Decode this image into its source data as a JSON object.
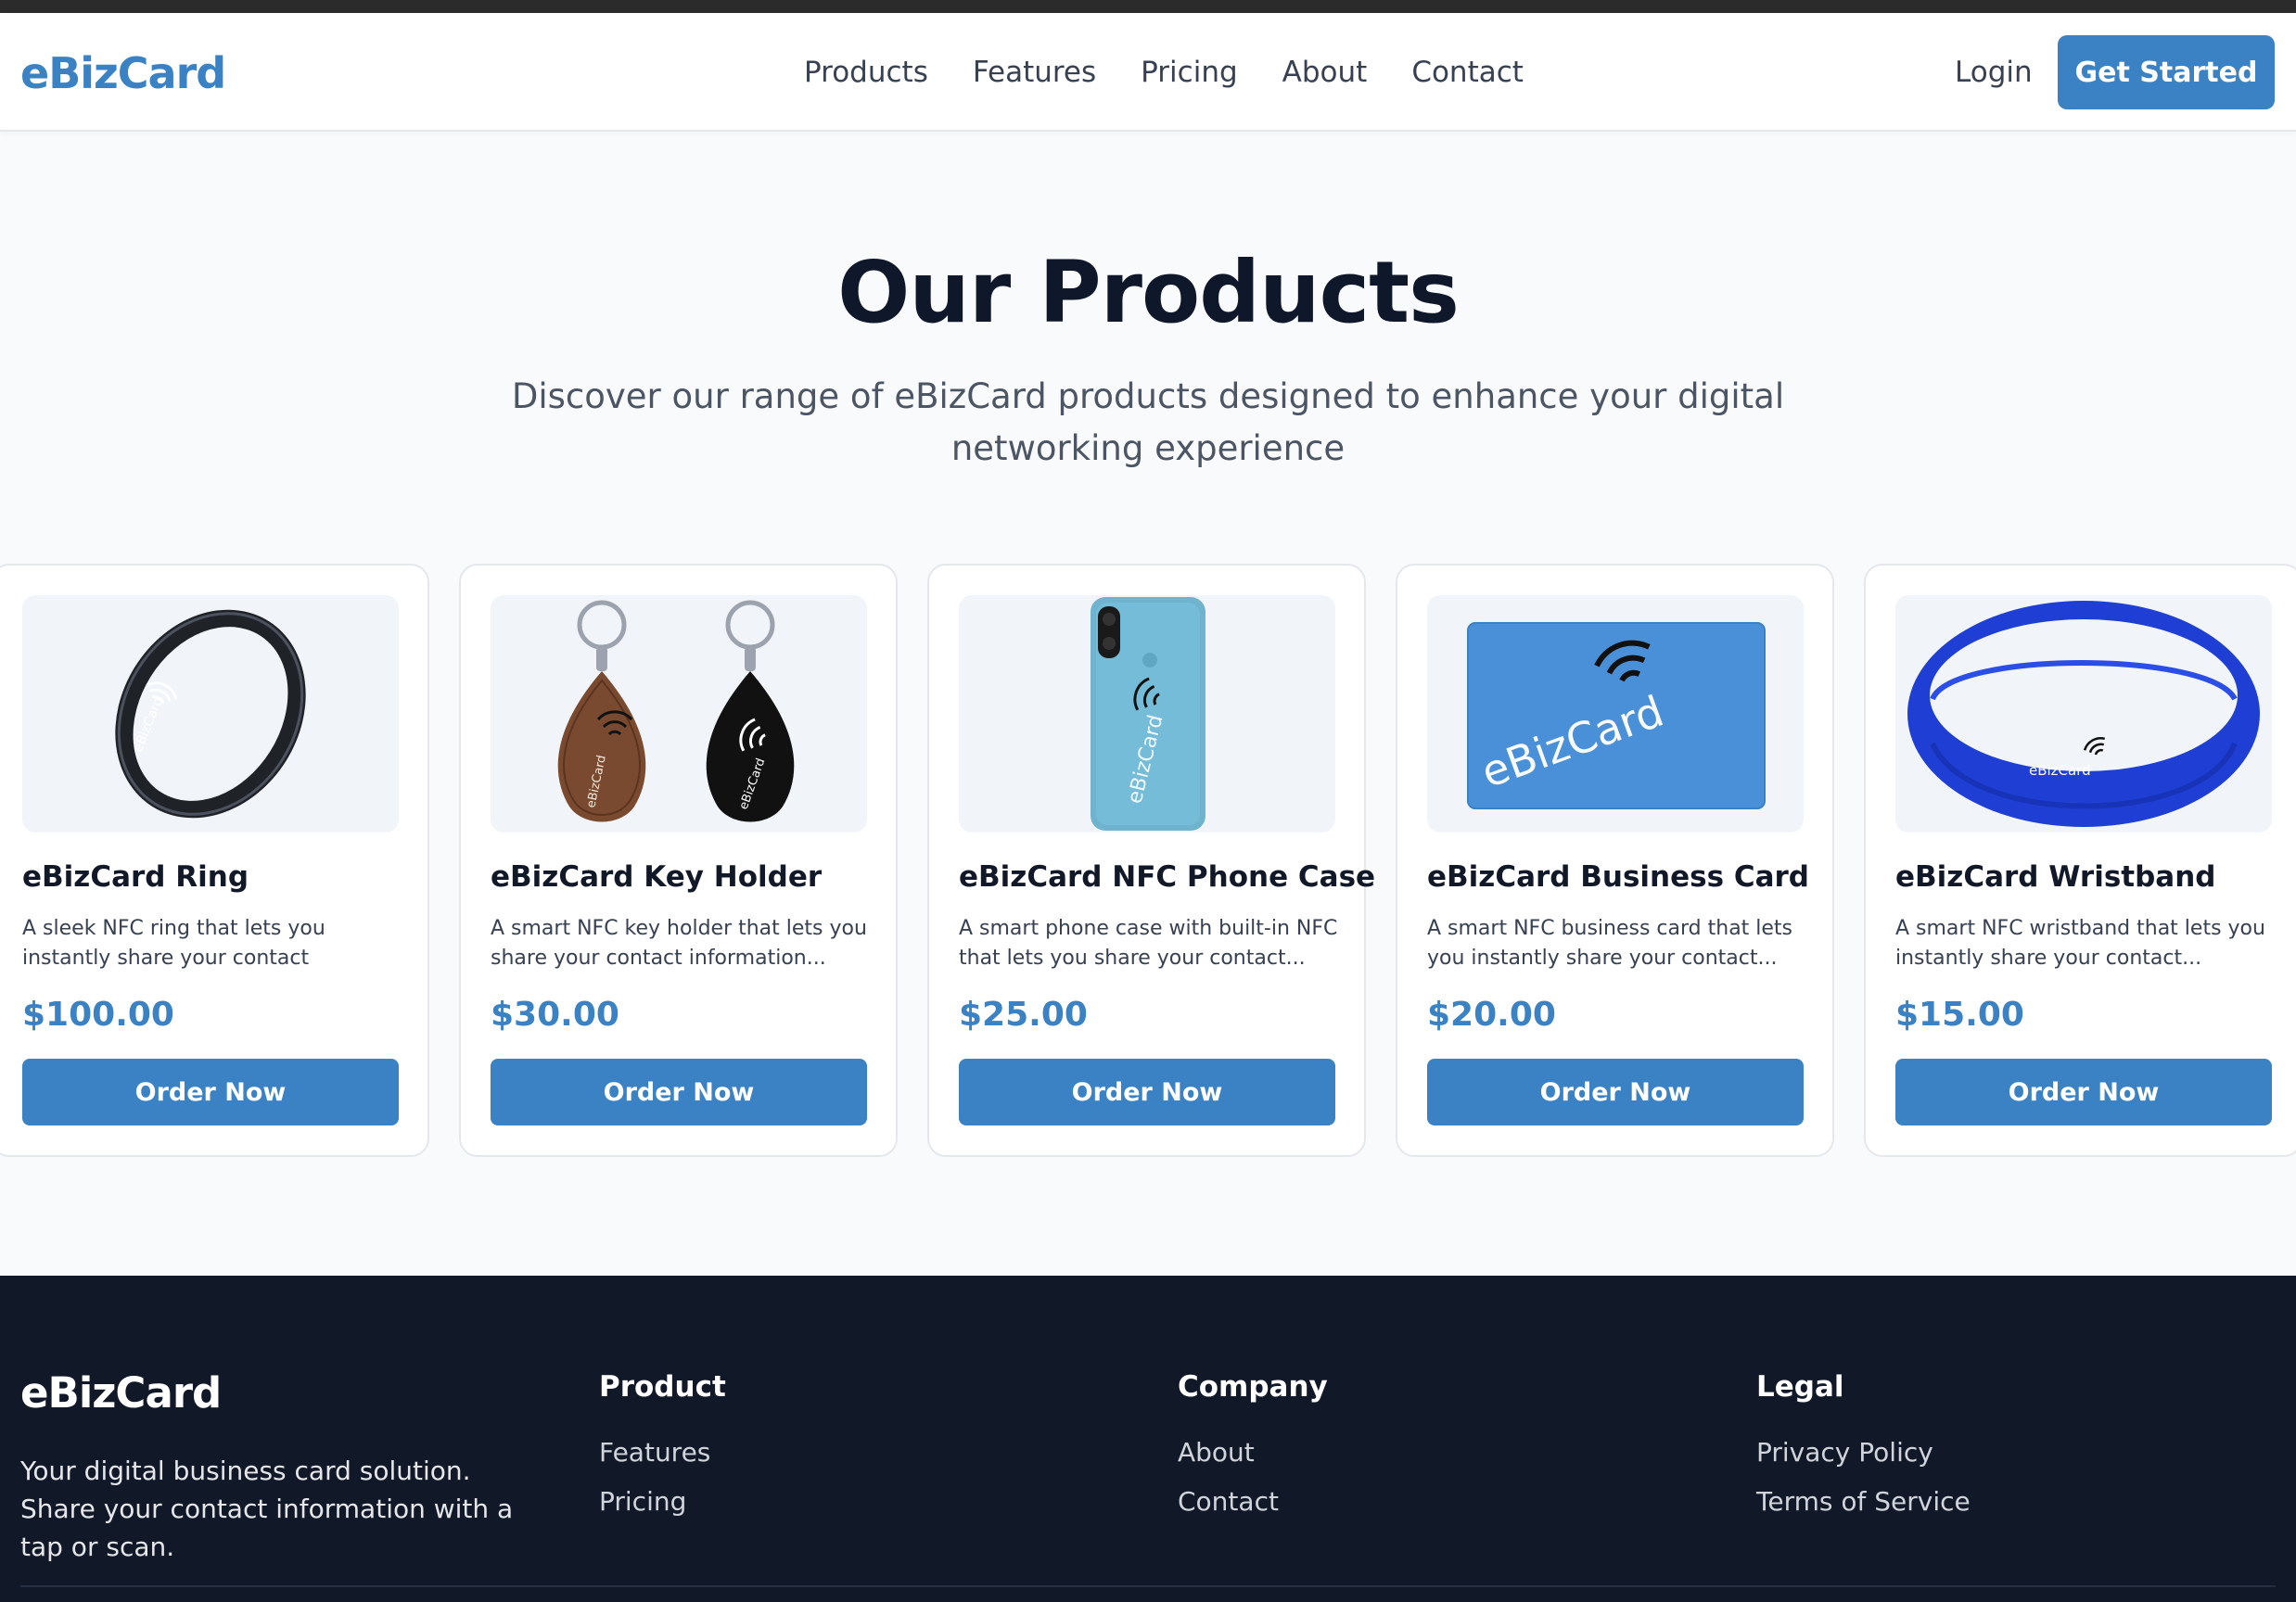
{
  "header": {
    "logo": "eBizCard",
    "nav": [
      "Products",
      "Features",
      "Pricing",
      "About",
      "Contact"
    ],
    "login": "Login",
    "cta": "Get Started"
  },
  "hero": {
    "title": "Our Products",
    "subtitle": "Discover our range of eBizCard products designed to enhance your digital networking experience"
  },
  "products": [
    {
      "name": "eBizCard Ring",
      "description": "A sleek NFC ring that lets you instantly share your contact information with ...",
      "price": "$100.00",
      "button": "Order Now",
      "image_icon": "ring-image",
      "image_text": "eBizCard"
    },
    {
      "name": "eBizCard Key Holder",
      "description": "A smart NFC key holder that lets you share your contact information...",
      "price": "$30.00",
      "button": "Order Now",
      "image_icon": "key-holder-image",
      "image_text": "eBizCard"
    },
    {
      "name": "eBizCard NFC Phone Case",
      "description": "A smart phone case with built-in NFC that lets you share your contact...",
      "price": "$25.00",
      "button": "Order Now",
      "image_icon": "phone-case-image",
      "image_text": "eBizCard"
    },
    {
      "name": "eBizCard Business Card",
      "description": "A smart NFC business card that lets you instantly share your contact...",
      "price": "$20.00",
      "button": "Order Now",
      "image_icon": "business-card-image",
      "image_text": "eBizCard"
    },
    {
      "name": "eBizCard Wristband",
      "description": "A smart NFC wristband that lets you instantly share your contact...",
      "price": "$15.00",
      "button": "Order Now",
      "image_icon": "wristband-image",
      "image_text": "eBizCard"
    }
  ],
  "footer": {
    "logo": "eBizCard",
    "tagline": "Your digital business card solution. Share your contact information with a tap or scan.",
    "columns": [
      {
        "title": "Product",
        "links": [
          "Features",
          "Pricing"
        ]
      },
      {
        "title": "Company",
        "links": [
          "About",
          "Contact"
        ]
      },
      {
        "title": "Legal",
        "links": [
          "Privacy Policy",
          "Terms of Service"
        ]
      }
    ]
  },
  "colors": {
    "accent": "#3b82c4",
    "footer_bg": "#111827",
    "page_bg": "#f8fafc"
  }
}
